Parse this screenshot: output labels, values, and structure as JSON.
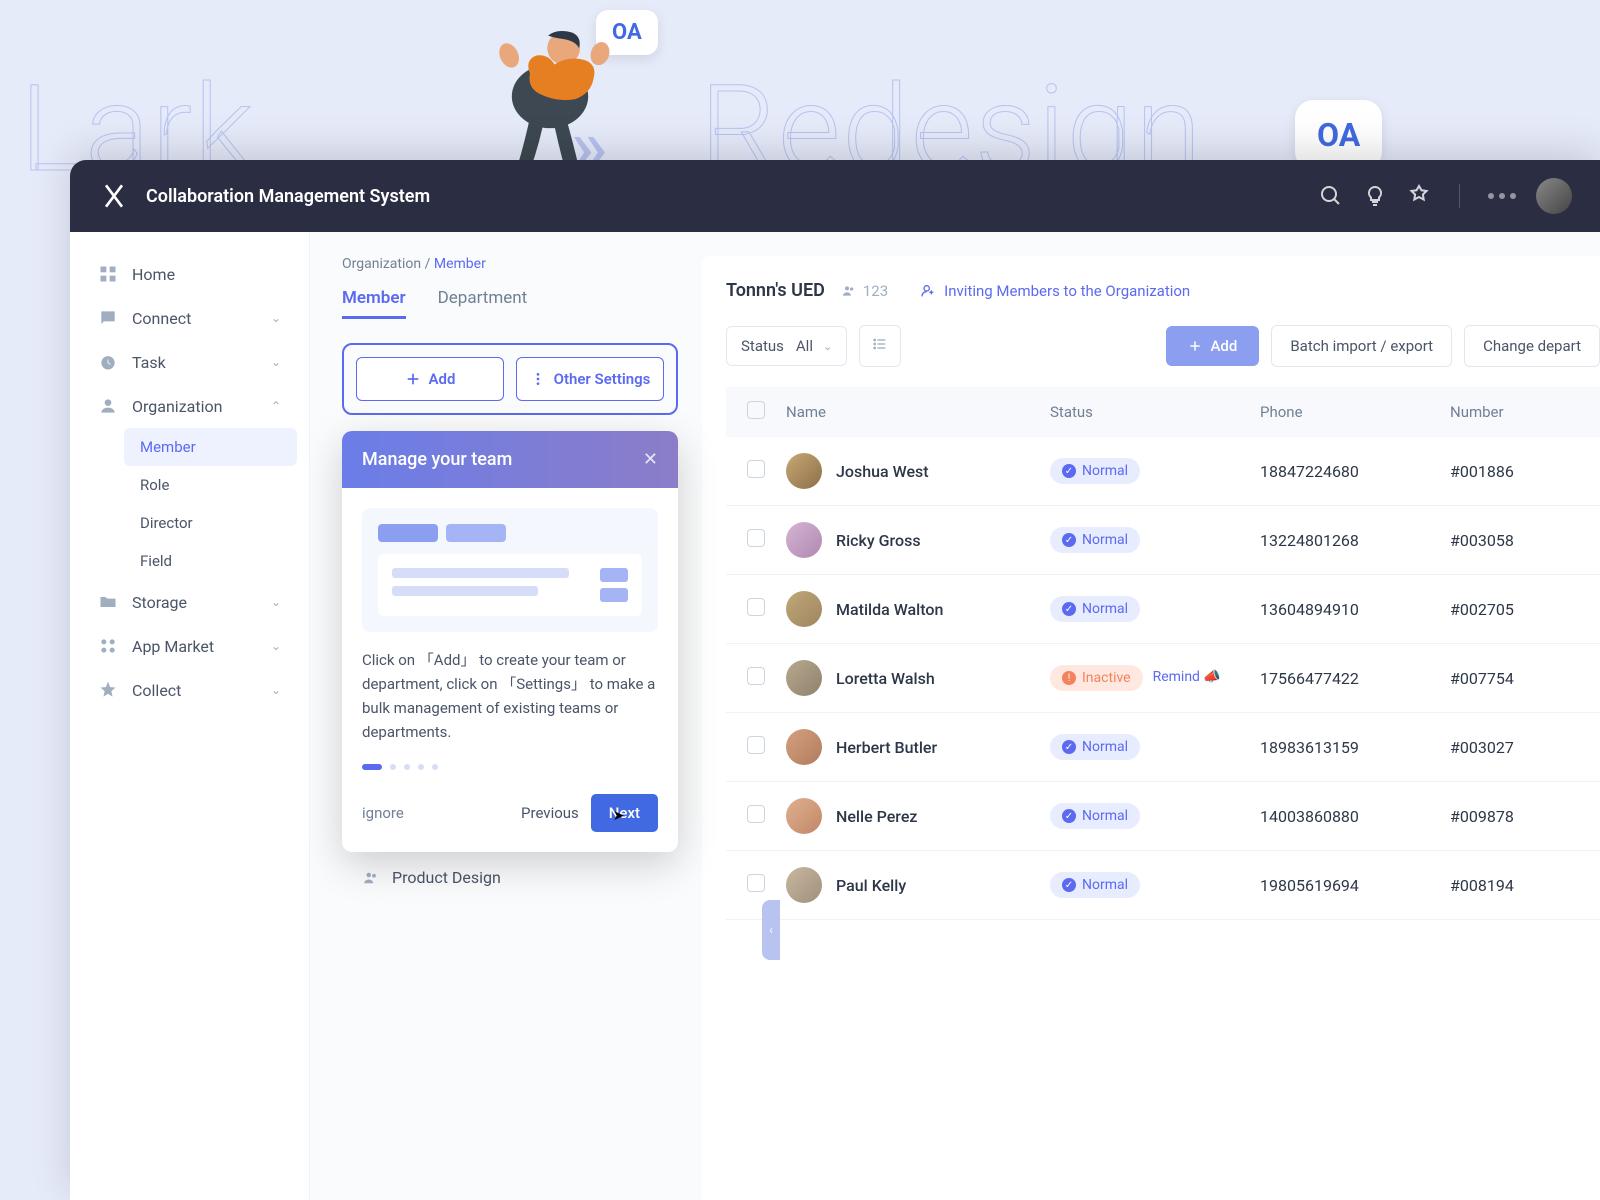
{
  "bg": {
    "lark": "Lark",
    "redesign": "Redesign",
    "oa": "OA"
  },
  "app_title": "Collaboration Management System",
  "sidebar": {
    "items": [
      {
        "label": "Home"
      },
      {
        "label": "Connect"
      },
      {
        "label": "Task"
      },
      {
        "label": "Organization"
      },
      {
        "label": "Storage"
      },
      {
        "label": "App Market"
      },
      {
        "label": "Collect"
      }
    ],
    "org_sub": [
      {
        "label": "Member"
      },
      {
        "label": "Role"
      },
      {
        "label": "Director"
      },
      {
        "label": "Field"
      }
    ]
  },
  "breadcrumb": {
    "parent": "Organization",
    "sep": " / ",
    "current": "Member"
  },
  "tabs": [
    {
      "label": "Member"
    },
    {
      "label": "Department"
    }
  ],
  "actions": {
    "add": "Add",
    "other": "Other Settings"
  },
  "popover": {
    "title": "Manage your team",
    "text": "Click on 「Add」 to create your team or department, click on 「Settings」 to make a bulk management of existing teams or departments.",
    "ignore": "ignore",
    "previous": "Previous",
    "next": "Next"
  },
  "product_design": "Product Design",
  "panel": {
    "title": "Tonnn's UED",
    "count": "123",
    "invite": "Inviting Members to the Organization"
  },
  "toolbar": {
    "status_label": "Status",
    "status_value": "All",
    "add": "Add",
    "batch": "Batch import / export",
    "change": "Change depart"
  },
  "columns": {
    "name": "Name",
    "status": "Status",
    "phone": "Phone",
    "number": "Number"
  },
  "status_labels": {
    "normal": "Normal",
    "inactive": "Inactive",
    "remind": "Remind"
  },
  "members": [
    {
      "name": "Joshua West",
      "status": "normal",
      "phone": "18847224680",
      "number": "#001886"
    },
    {
      "name": "Ricky Gross",
      "status": "normal",
      "phone": "13224801268",
      "number": "#003058"
    },
    {
      "name": "Matilda Walton",
      "status": "normal",
      "phone": "13604894910",
      "number": "#002705"
    },
    {
      "name": "Loretta Walsh",
      "status": "inactive",
      "phone": "17566477422",
      "number": "#007754"
    },
    {
      "name": "Herbert Butler",
      "status": "normal",
      "phone": "18983613159",
      "number": "#003027"
    },
    {
      "name": "Nelle Perez",
      "status": "normal",
      "phone": "14003860880",
      "number": "#009878"
    },
    {
      "name": "Paul Kelly",
      "status": "normal",
      "phone": "19805619694",
      "number": "#008194"
    }
  ]
}
